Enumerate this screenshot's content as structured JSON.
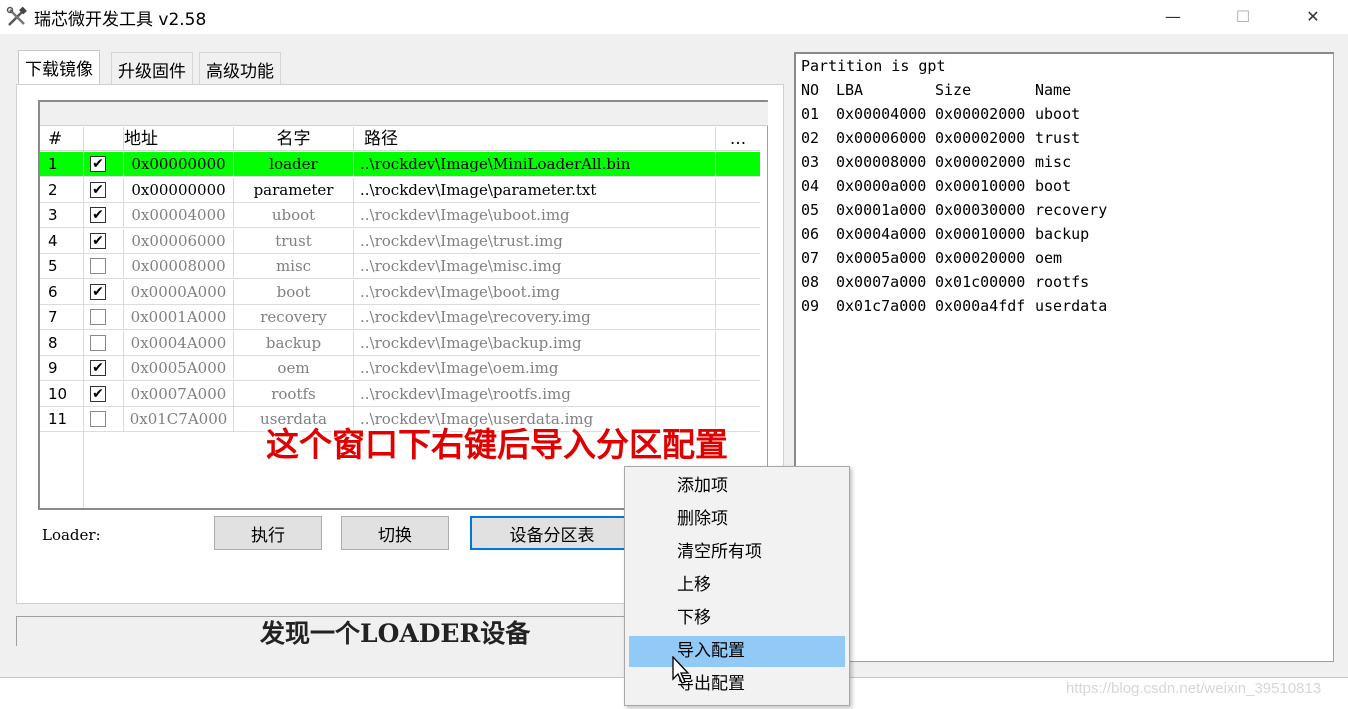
{
  "window": {
    "title": "瑞芯微开发工具 v2.58",
    "controls": {
      "minimize": "—",
      "maximize": "☐",
      "close": "✕"
    }
  },
  "tabs": [
    {
      "label": "下载镜像",
      "active": true
    },
    {
      "label": "升级固件",
      "active": false
    },
    {
      "label": "高级功能",
      "active": false
    }
  ],
  "list": {
    "headers": {
      "num": "#",
      "addr": "地址",
      "name": "名字",
      "path": "路径",
      "more": "..."
    },
    "rows": [
      {
        "num": "1",
        "checked": true,
        "addr": "0x00000000",
        "name": "loader",
        "path": "..\\rockdev\\Image\\MiniLoaderAll.bin",
        "selected": true
      },
      {
        "num": "2",
        "checked": true,
        "addr": "0x00000000",
        "name": "parameter",
        "path": "..\\rockdev\\Image\\parameter.txt",
        "bold": true
      },
      {
        "num": "3",
        "checked": true,
        "addr": "0x00004000",
        "name": "uboot",
        "path": "..\\rockdev\\Image\\uboot.img"
      },
      {
        "num": "4",
        "checked": true,
        "addr": "0x00006000",
        "name": "trust",
        "path": "..\\rockdev\\Image\\trust.img"
      },
      {
        "num": "5",
        "checked": false,
        "addr": "0x00008000",
        "name": "misc",
        "path": "..\\rockdev\\Image\\misc.img"
      },
      {
        "num": "6",
        "checked": true,
        "addr": "0x0000A000",
        "name": "boot",
        "path": "..\\rockdev\\Image\\boot.img"
      },
      {
        "num": "7",
        "checked": false,
        "addr": "0x0001A000",
        "name": "recovery",
        "path": "..\\rockdev\\Image\\recovery.img"
      },
      {
        "num": "8",
        "checked": false,
        "addr": "0x0004A000",
        "name": "backup",
        "path": "..\\rockdev\\Image\\backup.img"
      },
      {
        "num": "9",
        "checked": true,
        "addr": "0x0005A000",
        "name": "oem",
        "path": "..\\rockdev\\Image\\oem.img"
      },
      {
        "num": "10",
        "checked": true,
        "addr": "0x0007A000",
        "name": "rootfs",
        "path": "..\\rockdev\\Image\\rootfs.img"
      },
      {
        "num": "11",
        "checked": false,
        "addr": "0x01C7A000",
        "name": "userdata",
        "path": "..\\rockdev\\Image\\userdata.img"
      }
    ]
  },
  "controls": {
    "loader_label": "Loader:",
    "execute_label": "执行",
    "switch_label": "切换",
    "device_partition_label": "设备分区表"
  },
  "status": {
    "text": "发现一个LOADER设备"
  },
  "partition_info": {
    "title": "Partition is gpt",
    "headers": {
      "no": "NO",
      "lba": "LBA",
      "size": "Size",
      "name": "Name"
    },
    "rows": [
      {
        "no": "01",
        "lba": "0x00004000",
        "size": "0x00002000",
        "name": "uboot"
      },
      {
        "no": "02",
        "lba": "0x00006000",
        "size": "0x00002000",
        "name": "trust"
      },
      {
        "no": "03",
        "lba": "0x00008000",
        "size": "0x00002000",
        "name": "misc"
      },
      {
        "no": "04",
        "lba": "0x0000a000",
        "size": "0x00010000",
        "name": "boot"
      },
      {
        "no": "05",
        "lba": "0x0001a000",
        "size": "0x00030000",
        "name": "recovery"
      },
      {
        "no": "06",
        "lba": "0x0004a000",
        "size": "0x00010000",
        "name": "backup"
      },
      {
        "no": "07",
        "lba": "0x0005a000",
        "size": "0x00020000",
        "name": "oem"
      },
      {
        "no": "08",
        "lba": "0x0007a000",
        "size": "0x01c00000",
        "name": "rootfs"
      },
      {
        "no": "09",
        "lba": "0x01c7a000",
        "size": "0x000a4fdf",
        "name": "userdata"
      }
    ]
  },
  "annotation": {
    "text": "这个窗口下右键后导入分区配置",
    "color": "#e10000"
  },
  "context_menu": {
    "items": [
      {
        "label": "添加项"
      },
      {
        "label": "删除项"
      },
      {
        "label": "清空所有项"
      },
      {
        "label": "上移"
      },
      {
        "label": "下移"
      },
      {
        "label": "导入配置",
        "hover": true
      },
      {
        "label": "导出配置"
      }
    ]
  },
  "watermark": {
    "text": "https://blog.csdn.net/weixin_39510813"
  },
  "colors": {
    "selected_row": "#00ff00",
    "menu_hover": "#91c9f7",
    "default_button_border": "#0078d7"
  }
}
